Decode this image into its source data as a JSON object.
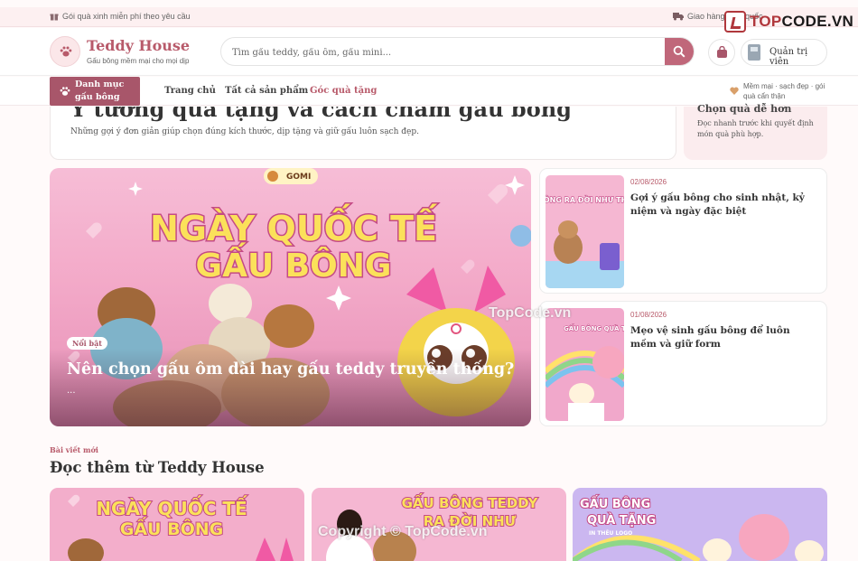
{
  "topbar": {
    "promo": "Gói quà xinh miễn phí theo yêu cầu",
    "shipping": "Giao hàng toàn quốc"
  },
  "watermark": {
    "logo_prefix": "TOP",
    "logo_suffix": "CODE.VN",
    "center": "TopCode.vn",
    "bottom": "Copyright © TopCode.vn"
  },
  "header": {
    "brand": "Teddy House",
    "tagline": "Gấu bông mềm mại cho mọi dịp",
    "search_placeholder": "Tìm gấu teddy, gấu ôm, gấu mini...",
    "admin_label": "Quản trị viên"
  },
  "nav": {
    "category_label": "Danh mục gấu bông",
    "links": [
      "Trang chủ",
      "Tất cả sản phẩm",
      "Góc quà tặng"
    ],
    "active_index": 2,
    "note": "Mềm mại · sạch đẹp · gói quà cẩn thận"
  },
  "intro": {
    "title": "Ý tưởng quà tặng và cách chăm gấu bông",
    "subtitle": "Những gợi ý đơn giản giúp chọn đúng kích thước, dịp tặng và giữ gấu luôn sạch đẹp.",
    "tip_title": "Chọn quà dễ hơn",
    "tip_text": "Đọc nhanh trước khi quyết định món quà phù hợp."
  },
  "hero": {
    "badge": "Nổi bật",
    "title": "Nên chọn gấu ôm dài hay gấu teddy truyền thống?",
    "excerpt": "...",
    "image_text_line1": "NGÀY QUỐC TẾ",
    "image_text_line2": "GẤU BÔNG",
    "image_brand": "GOMI"
  },
  "side_posts": [
    {
      "date": "02/08/2026",
      "title": "Gợi ý gấu bông cho sinh nhật, kỷ niệm và ngày đặc biệt",
      "thumb_text": "GẤU BÔNG RA ĐỜI NHƯ THẾ NÀO"
    },
    {
      "date": "01/08/2026",
      "title": "Mẹo vệ sinh gấu bông để luôn mềm và giữ form",
      "thumb_text": "GẤU BÔNG QUÀ TẶNG"
    }
  ],
  "more": {
    "kicker": "Bài viết mới",
    "title": "Đọc thêm từ Teddy House",
    "cards": [
      {
        "line1": "NGÀY QUỐC TẾ",
        "line2": "GẤU BÔNG"
      },
      {
        "line1": "GẤU BÔNG TEDDY",
        "line2": "RA ĐỜI NHƯ"
      },
      {
        "line1": "GẤU BÔNG",
        "line2": "QUÀ TẶNG",
        "line3": "IN THÊU LOGO"
      }
    ]
  },
  "colors": {
    "accent": "#b85a6a",
    "category_bg": "#a8566a",
    "search_button": "#c0677a",
    "topbar_bg": "#fdf0f1",
    "tip_bg": "#fbecee"
  },
  "icons": {
    "topbar_left": "gift-icon",
    "topbar_right": "truck-icon",
    "logo": "paw-icon",
    "search": "search-icon",
    "cart": "shopping-bag-icon",
    "nav_note": "heart-icon"
  }
}
